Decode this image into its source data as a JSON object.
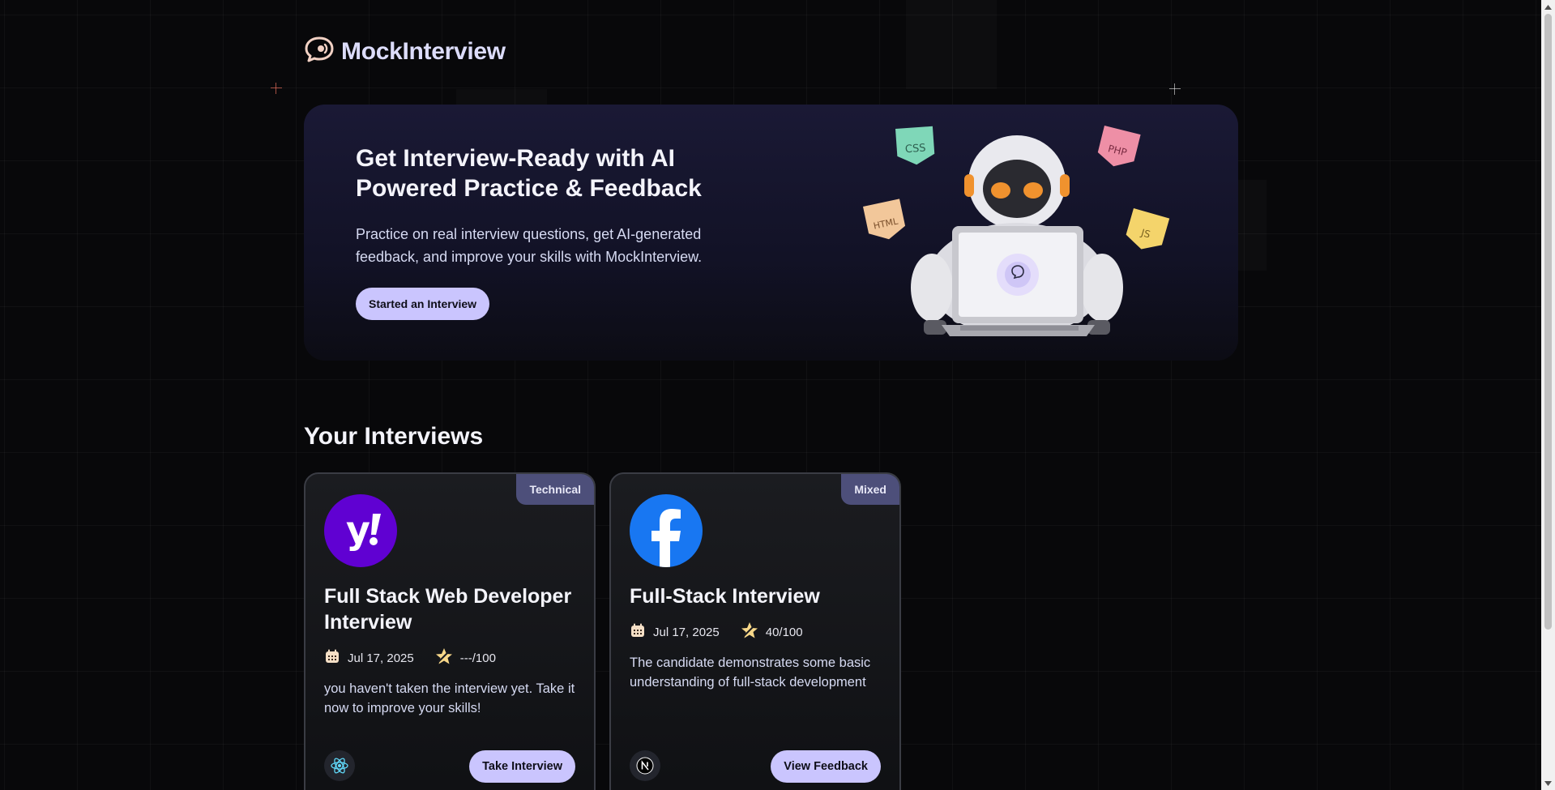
{
  "app": {
    "name": "MockInterview"
  },
  "hero": {
    "title": "Get Interview-Ready with AI Powered Practice & Feedback",
    "subtitle": "Practice on real interview questions, get AI-generated feedback, and improve your skills with MockInterview.",
    "cta_label": "Started an Interview",
    "art_tags": [
      "CSS",
      "PHP",
      "HTML",
      "JS"
    ]
  },
  "section": {
    "title": "Your Interviews"
  },
  "interviews": [
    {
      "badge": "Technical",
      "company_icon": "yahoo-logo",
      "title": "Full Stack Web Developer Interview",
      "date": "Jul 17, 2025",
      "score": "---/100",
      "description": "you haven't taken the interview yet. Take it now to improve your skills!",
      "tech_icon": "react-icon",
      "action_label": "Take Interview"
    },
    {
      "badge": "Mixed",
      "company_icon": "facebook-logo",
      "title": "Full-Stack Interview",
      "date": "Jul 17, 2025",
      "score": "40/100",
      "description": "The candidate demonstrates some basic understanding of full-stack development and related concepts.",
      "tech_icon": "nextjs-icon",
      "action_label": "View Feedback"
    }
  ],
  "colors": {
    "accent": "#cac5fe",
    "badge": "#4d4f7a",
    "background": "#08080a",
    "yahoo": "#6001d2",
    "facebook": "#1877f2"
  }
}
